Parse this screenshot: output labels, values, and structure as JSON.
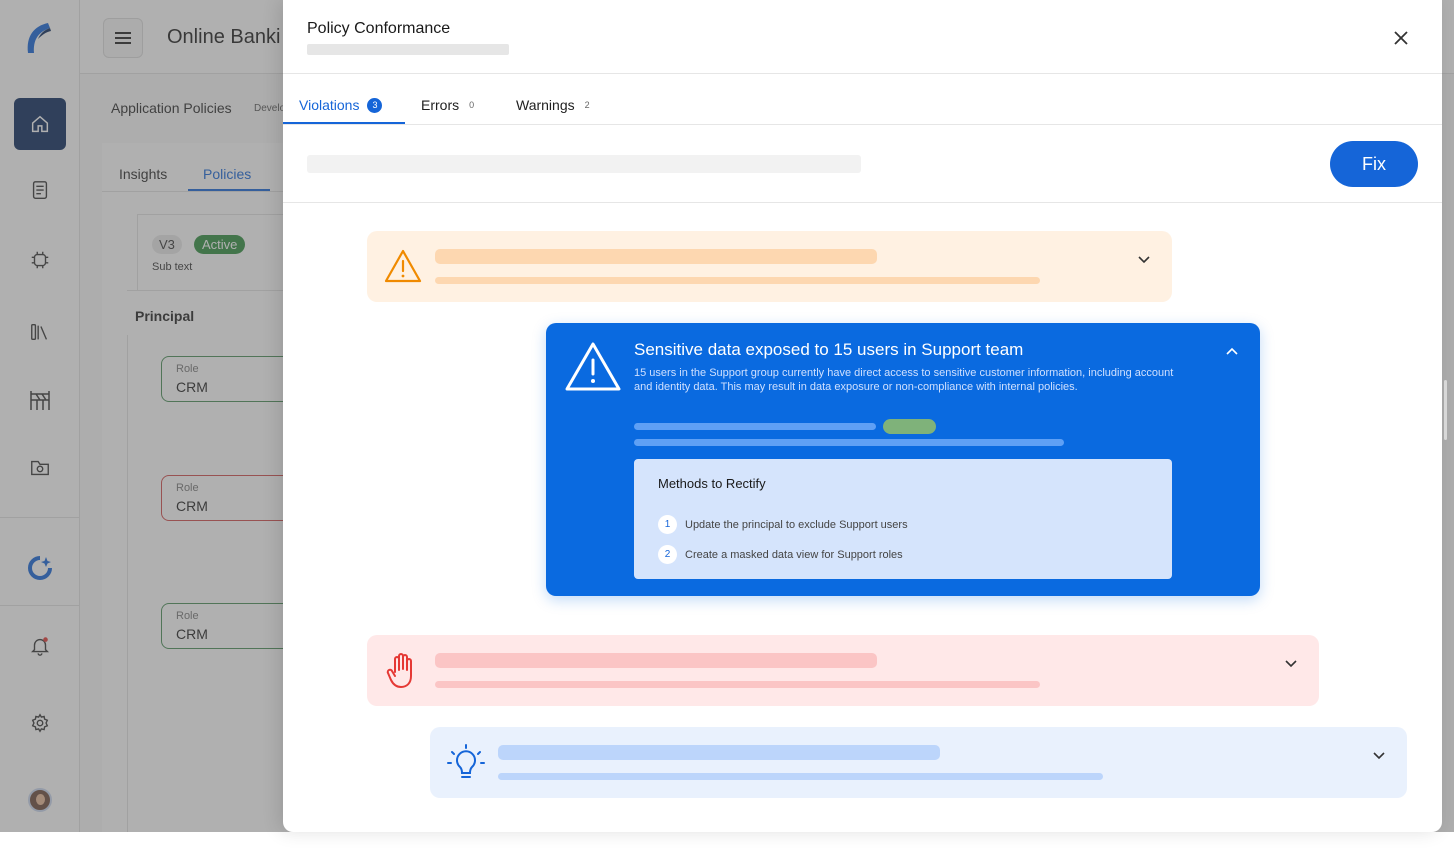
{
  "app": {
    "title": "Online Banki",
    "breadcrumb": "Application Policies",
    "breadcrumb_tag": "Develo",
    "tabs": [
      "Insights",
      "Policies"
    ],
    "version": "V3",
    "status": "Active",
    "sub_text": "Sub text",
    "principal_heading": "Principal",
    "roles": [
      {
        "label": "Role",
        "value": "CRM",
        "state": "ok"
      },
      {
        "label": "Role",
        "value": "CRM",
        "state": "error"
      },
      {
        "label": "Role",
        "value": "CRM",
        "state": "ok"
      }
    ]
  },
  "modal": {
    "title": "Policy Conformance",
    "tabs": [
      {
        "label": "Violations",
        "count": "3",
        "active": true
      },
      {
        "label": "Errors",
        "count": "0",
        "active": false
      },
      {
        "label": "Warnings",
        "count": "2",
        "active": false
      }
    ],
    "fix_label": "Fix",
    "expanded_issue": {
      "title": "Sensitive data exposed to 15 users in Support team",
      "description": "15 users in the Support group currently have direct access to sensitive customer information, including account and identity data. This may result in data exposure or non-compliance with internal policies.",
      "methods_title": "Methods to Rectify",
      "methods": [
        {
          "num": "1",
          "text": "Update the principal to exclude Support users"
        },
        {
          "num": "2",
          "text": "Create a masked data view for Support roles"
        }
      ]
    },
    "collapsed_issues": [
      {
        "kind": "warning",
        "icon": "warning-triangle-icon"
      },
      {
        "kind": "blocked",
        "icon": "hand-stop-icon"
      },
      {
        "kind": "suggestion",
        "icon": "lightbulb-icon"
      }
    ]
  },
  "colors": {
    "accent": "#1565d8",
    "warning_bg": "#fff1e2",
    "error_bg": "#ffe8e8",
    "info_bg": "#e9f1fd",
    "active_green": "#2f8f3e"
  }
}
